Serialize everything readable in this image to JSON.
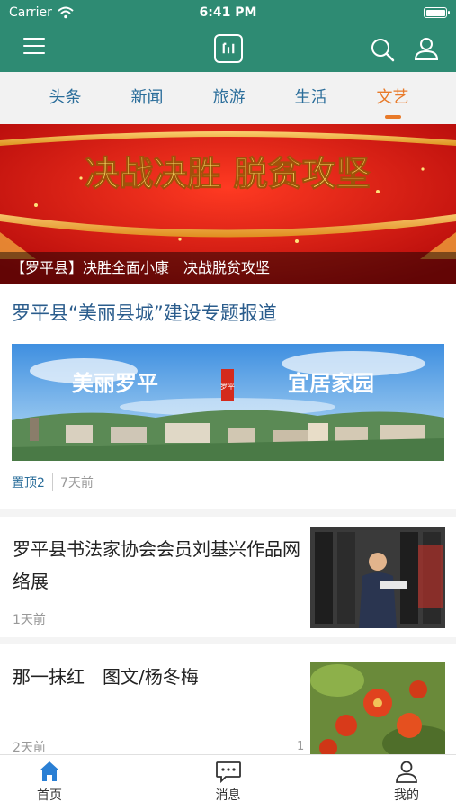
{
  "status_bar": {
    "carrier": "Carrier",
    "time": "6:41 PM"
  },
  "header": {
    "menu_icon": "hamburger-icon",
    "logo_icon": "app-logo",
    "search_icon": "search-icon",
    "user_icon": "user-icon",
    "brand_color": "#2e8b73"
  },
  "tabs": [
    {
      "label": "头条",
      "active": false
    },
    {
      "label": "新闻",
      "active": false
    },
    {
      "label": "旅游",
      "active": false
    },
    {
      "label": "生活",
      "active": false
    },
    {
      "label": "文艺",
      "active": true
    }
  ],
  "banner": {
    "headline": "决战决胜 脱贫攻坚",
    "caption": "【罗平县】决胜全面小康　决战脱贫攻坚"
  },
  "feature": {
    "title": "罗平县“美丽县城”建设专题报道",
    "image_text_left": "美丽罗平",
    "image_text_seal": "罗平",
    "image_text_right": "宜居家园",
    "pin": "置顶2",
    "time": "7天前"
  },
  "articles": [
    {
      "title": "罗平县书法家协会会员刘基兴作品网络展",
      "time": "1天前",
      "count": ""
    },
    {
      "title": "那一抹红　图文/杨冬梅",
      "time": "2天前",
      "count": "1"
    }
  ],
  "tabbar": [
    {
      "label": "首页",
      "icon": "home-icon",
      "active": true
    },
    {
      "label": "消息",
      "icon": "message-icon",
      "active": false
    },
    {
      "label": "我的",
      "icon": "profile-icon",
      "active": false
    }
  ],
  "colors": {
    "accent": "#e87a2a",
    "link": "#2a6d9a",
    "title_blue": "#2a5c8c"
  }
}
